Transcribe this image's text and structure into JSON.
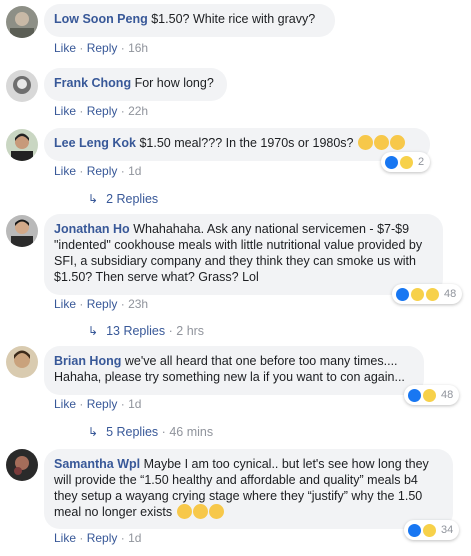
{
  "comments": [
    {
      "author": "Low Soon Peng",
      "text": "$1.50? White rice with gravy?",
      "like": "Like",
      "reply": "Reply",
      "time": "16h"
    },
    {
      "author": "Frank Chong",
      "text": "For how long?",
      "like": "Like",
      "reply": "Reply",
      "time": "22h"
    },
    {
      "author": "Lee Leng Kok",
      "text": "$1.50 meal??? In the 1970s or 1980s?",
      "like": "Like",
      "reply": "Reply",
      "time": "1d",
      "reaction_count": "2",
      "replies_label": "2 Replies"
    },
    {
      "author": "Jonathan Ho",
      "text": "Whahahaha. Ask any national servicemen - $7-$9 \"indented\" cookhouse meals with little nutritional value provided by SFI, a subsidiary company and they think they can smoke us with $1.50? Then serve what? Grass? Lol",
      "like": "Like",
      "reply": "Reply",
      "time": "23h",
      "reaction_count": "48",
      "replies_label": "13 Replies",
      "replies_time": "2 hrs"
    },
    {
      "author": "Brian Hong",
      "text": "we've all heard that one before too many times.... Hahaha, please try something new la if you want to con again...",
      "like": "Like",
      "reply": "Reply",
      "time": "1d",
      "reaction_count": "48",
      "replies_label": "5 Replies",
      "replies_time": "46 mins"
    },
    {
      "author": "Samantha Wpl",
      "text": "Maybe I am too cynical.. but let's see how long they will provide the “1.50 healthy and affordable and quality” meals b4 they setup a wayang crying stage where they “justify” why the 1.50 meal no longer exists",
      "like": "Like",
      "reply": "Reply",
      "time": "1d",
      "reaction_count": "34"
    }
  ],
  "colors": {
    "link": "#385898",
    "bubble": "#f2f3f5",
    "meta": "#90949c",
    "like_blue": "#1877f2",
    "emoji_yellow": "#f7d14a"
  }
}
